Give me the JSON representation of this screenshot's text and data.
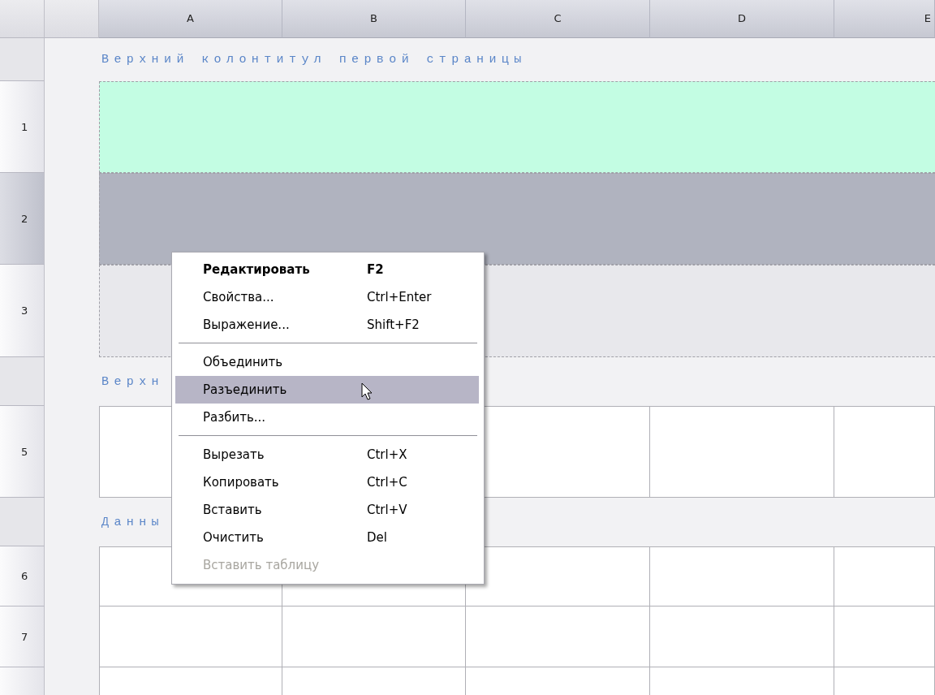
{
  "columns": [
    "A",
    "B",
    "C",
    "D",
    "E"
  ],
  "rows": [
    {
      "kind": "band",
      "title": "Верхний колонтитул первой страницы"
    },
    {
      "kind": "merged",
      "number": "1",
      "color": "#c3fde3",
      "selected": false
    },
    {
      "kind": "merged",
      "number": "2",
      "color": "#b0b3bf",
      "selected": true
    },
    {
      "kind": "merged",
      "number": "3",
      "color": "#e8e8ec",
      "selected": false
    },
    {
      "kind": "band",
      "title": "Верхн"
    },
    {
      "kind": "cells",
      "number": "5"
    },
    {
      "kind": "band",
      "title": "Данны"
    },
    {
      "kind": "cells",
      "number": "6"
    },
    {
      "kind": "cells",
      "number": "7"
    },
    {
      "kind": "cells"
    }
  ],
  "context_menu": [
    {
      "kind": "item",
      "label": "Редактировать",
      "shortcut": "F2",
      "default": true,
      "selected": false,
      "disabled": false
    },
    {
      "kind": "item",
      "label": "Свойства...",
      "shortcut": "Ctrl+Enter",
      "default": false,
      "selected": false,
      "disabled": false
    },
    {
      "kind": "item",
      "label": "Выражение...",
      "shortcut": "Shift+F2",
      "default": false,
      "selected": false,
      "disabled": false
    },
    {
      "kind": "separator"
    },
    {
      "kind": "item",
      "label": "Объединить",
      "default": false,
      "selected": false,
      "disabled": false
    },
    {
      "kind": "item",
      "label": "Разъединить",
      "default": false,
      "selected": true,
      "disabled": false
    },
    {
      "kind": "item",
      "label": "Разбить...",
      "default": false,
      "selected": false,
      "disabled": false
    },
    {
      "kind": "separator"
    },
    {
      "kind": "item",
      "label": "Вырезать",
      "shortcut": "Ctrl+X",
      "default": false,
      "selected": false,
      "disabled": false
    },
    {
      "kind": "item",
      "label": "Копировать",
      "shortcut": "Ctrl+C",
      "default": false,
      "selected": false,
      "disabled": false
    },
    {
      "kind": "item",
      "label": "Вставить",
      "shortcut": "Ctrl+V",
      "default": false,
      "selected": false,
      "disabled": false
    },
    {
      "kind": "item",
      "label": "Очистить",
      "shortcut": "Del",
      "default": false,
      "selected": false,
      "disabled": false
    },
    {
      "kind": "item",
      "label": "Вставить таблицу",
      "default": false,
      "selected": false,
      "disabled": true
    }
  ]
}
